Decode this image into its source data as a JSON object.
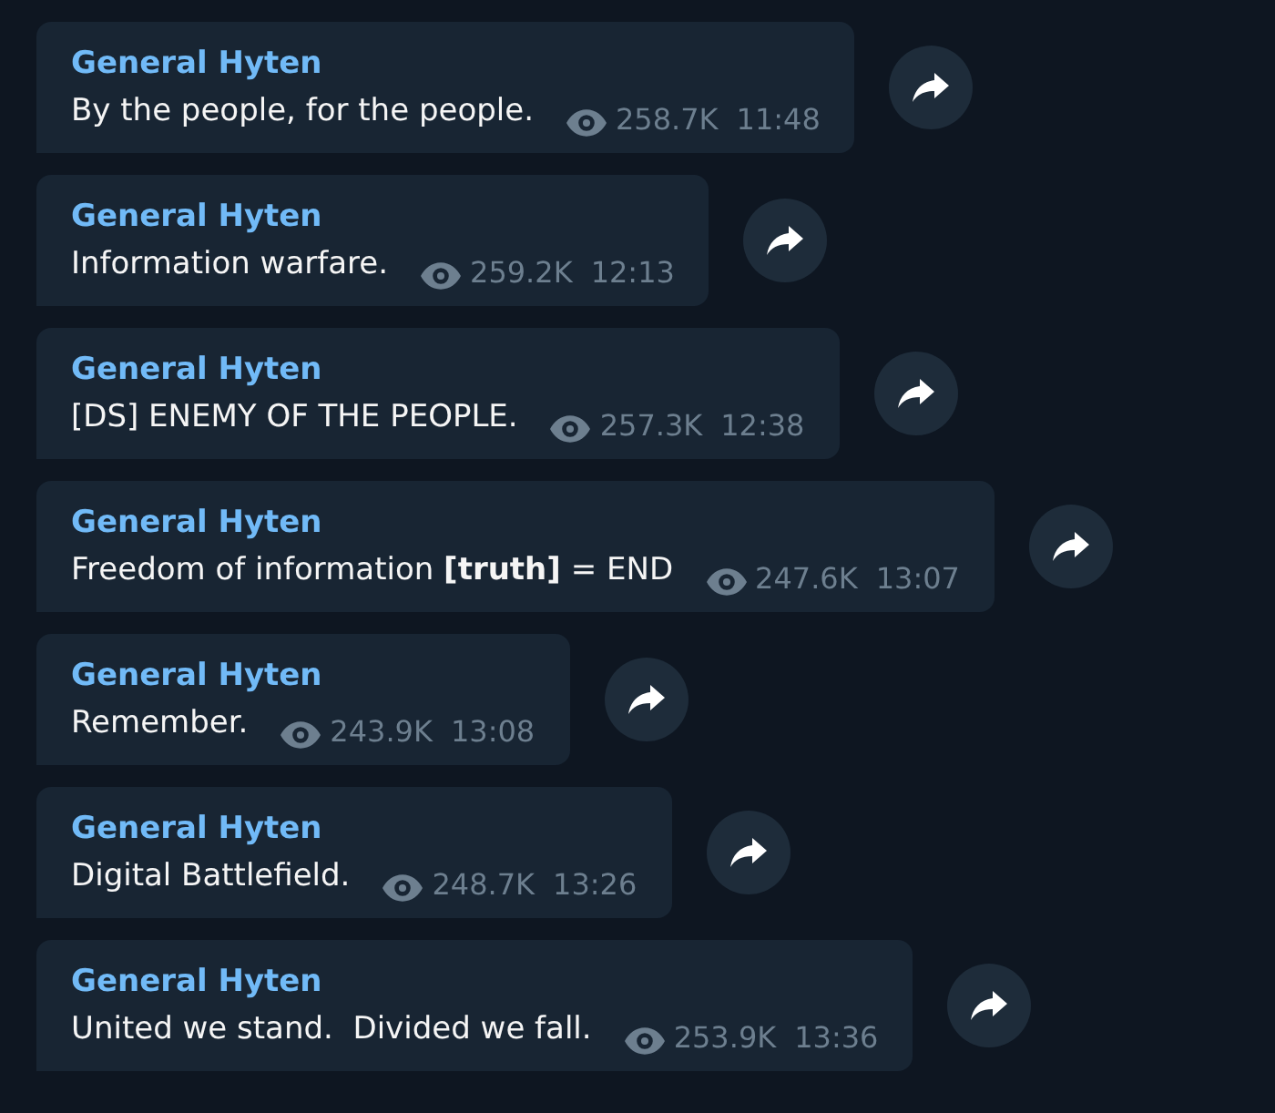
{
  "messages": [
    {
      "author": "General Hyten",
      "text": "By the people, for the people.",
      "views": "258.7K",
      "time": "11:48"
    },
    {
      "author": "General Hyten",
      "text": "Information warfare.",
      "views": "259.2K",
      "time": "12:13"
    },
    {
      "author": "General Hyten",
      "text": "[DS] ENEMY OF THE PEOPLE.",
      "views": "257.3K",
      "time": "12:38"
    },
    {
      "author": "General Hyten",
      "text": "Freedom of information **[truth]** = END",
      "views": "247.6K",
      "time": "13:07"
    },
    {
      "author": "General Hyten",
      "text": "Remember.",
      "views": "243.9K",
      "time": "13:08"
    },
    {
      "author": "General Hyten",
      "text": "Digital Battlefield.",
      "views": "248.7K",
      "time": "13:26"
    },
    {
      "author": "General Hyten",
      "text": "United we stand.  Divided we fall.",
      "views": "253.9K",
      "time": "13:36"
    }
  ]
}
